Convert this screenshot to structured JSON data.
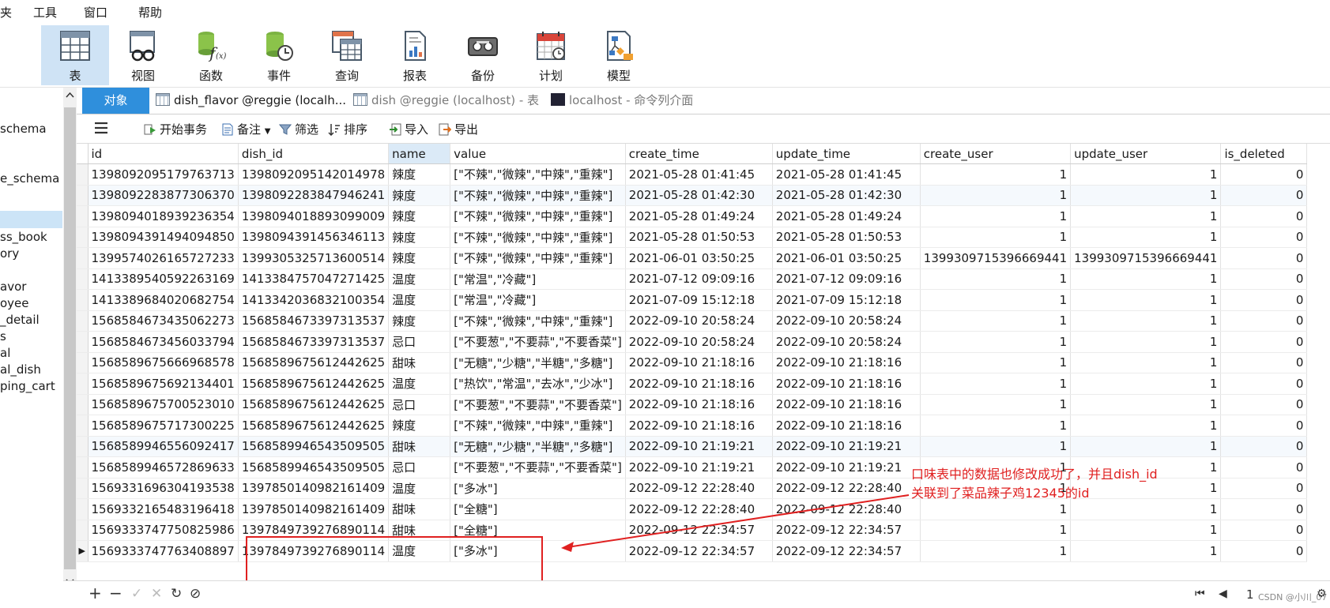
{
  "menu": [
    "夹",
    "工具",
    "窗口",
    "帮助"
  ],
  "toolbar": [
    {
      "label": "表",
      "icon": "table-icon",
      "active": true
    },
    {
      "label": "视图",
      "icon": "view-icon"
    },
    {
      "label": "函数",
      "icon": "function-icon"
    },
    {
      "label": "事件",
      "icon": "event-icon"
    },
    {
      "label": "查询",
      "icon": "query-icon"
    },
    {
      "label": "报表",
      "icon": "report-icon"
    },
    {
      "label": "备份",
      "icon": "backup-icon"
    },
    {
      "label": "计划",
      "icon": "schedule-icon"
    },
    {
      "label": "模型",
      "icon": "model-icon"
    }
  ],
  "sidebar": [
    "schema",
    "e_schema",
    "ss_book",
    "ory",
    "avor",
    "oyee",
    "_detail",
    "s",
    "al",
    "al_dish",
    "ping_cart"
  ],
  "tabs": {
    "objects": "对象",
    "tab1": "dish_flavor @reggie (localh...",
    "tab2": "dish @reggie (localhost) - 表",
    "tab3": "localhost - 命令列介面"
  },
  "grid_toolbar": {
    "begin": "开始事务",
    "notes": "备注",
    "filter": "筛选",
    "sort": "排序",
    "import": "导入",
    "export": "导出"
  },
  "columns": [
    "id",
    "dish_id",
    "name",
    "value",
    "create_time",
    "update_time",
    "create_user",
    "update_user",
    "is_deleted"
  ],
  "rows": [
    [
      "1398092095179763713",
      "1398092095142014978",
      "辣度",
      "[\"不辣\",\"微辣\",\"中辣\",\"重辣\"]",
      "2021-05-28 01:41:45",
      "2021-05-28 01:41:45",
      "1",
      "1",
      "0"
    ],
    [
      "1398092283877306370",
      "1398092283847946241",
      "辣度",
      "[\"不辣\",\"微辣\",\"中辣\",\"重辣\"]",
      "2021-05-28 01:42:30",
      "2021-05-28 01:42:30",
      "1",
      "1",
      "0"
    ],
    [
      "1398094018939236354",
      "1398094018893099009",
      "辣度",
      "[\"不辣\",\"微辣\",\"中辣\",\"重辣\"]",
      "2021-05-28 01:49:24",
      "2021-05-28 01:49:24",
      "1",
      "1",
      "0"
    ],
    [
      "1398094391494094850",
      "1398094391456346113",
      "辣度",
      "[\"不辣\",\"微辣\",\"中辣\",\"重辣\"]",
      "2021-05-28 01:50:53",
      "2021-05-28 01:50:53",
      "1",
      "1",
      "0"
    ],
    [
      "1399574026165727233",
      "1399305325713600514",
      "辣度",
      "[\"不辣\",\"微辣\",\"中辣\",\"重辣\"]",
      "2021-06-01 03:50:25",
      "2021-06-01 03:50:25",
      "1399309715396669441",
      "1399309715396669441",
      "0"
    ],
    [
      "1413389540592263169",
      "1413384757047271425",
      "温度",
      "[\"常温\",\"冷藏\"]",
      "2021-07-12 09:09:16",
      "2021-07-12 09:09:16",
      "1",
      "1",
      "0"
    ],
    [
      "1413389684020682754",
      "1413342036832100354",
      "温度",
      "[\"常温\",\"冷藏\"]",
      "2021-07-09 15:12:18",
      "2021-07-09 15:12:18",
      "1",
      "1",
      "0"
    ],
    [
      "1568584673435062273",
      "1568584673397313537",
      "辣度",
      "[\"不辣\",\"微辣\",\"中辣\",\"重辣\"]",
      "2022-09-10 20:58:24",
      "2022-09-10 20:58:24",
      "1",
      "1",
      "0"
    ],
    [
      "1568584673456033794",
      "1568584673397313537",
      "忌口",
      "[\"不要葱\",\"不要蒜\",\"不要香菜\"]",
      "2022-09-10 20:58:24",
      "2022-09-10 20:58:24",
      "1",
      "1",
      "0"
    ],
    [
      "1568589675666968578",
      "1568589675612442625",
      "甜味",
      "[\"无糖\",\"少糖\",\"半糖\",\"多糖\"]",
      "2022-09-10 21:18:16",
      "2022-09-10 21:18:16",
      "1",
      "1",
      "0"
    ],
    [
      "1568589675692134401",
      "1568589675612442625",
      "温度",
      "[\"热饮\",\"常温\",\"去冰\",\"少冰\"]",
      "2022-09-10 21:18:16",
      "2022-09-10 21:18:16",
      "1",
      "1",
      "0"
    ],
    [
      "1568589675700523010",
      "1568589675612442625",
      "忌口",
      "[\"不要葱\",\"不要蒜\",\"不要香菜\"]",
      "2022-09-10 21:18:16",
      "2022-09-10 21:18:16",
      "1",
      "1",
      "0"
    ],
    [
      "1568589675717300225",
      "1568589675612442625",
      "辣度",
      "[\"不辣\",\"微辣\",\"中辣\",\"重辣\"]",
      "2022-09-10 21:18:16",
      "2022-09-10 21:18:16",
      "1",
      "1",
      "0"
    ],
    [
      "1568589946556092417",
      "1568589946543509505",
      "甜味",
      "[\"无糖\",\"少糖\",\"半糖\",\"多糖\"]",
      "2022-09-10 21:19:21",
      "2022-09-10 21:19:21",
      "1",
      "1",
      "0"
    ],
    [
      "1568589946572869633",
      "1568589946543509505",
      "忌口",
      "[\"不要葱\",\"不要蒜\",\"不要香菜\"]",
      "2022-09-10 21:19:21",
      "2022-09-10 21:19:21",
      "1",
      "1",
      "0"
    ],
    [
      "1569331696304193538",
      "1397850140982161409",
      "温度",
      "[\"多冰\"]",
      "2022-09-12 22:28:40",
      "2022-09-12 22:28:40",
      "1",
      "1",
      "0"
    ],
    [
      "1569332165483196418",
      "1397850140982161409",
      "甜味",
      "[\"全糖\"]",
      "2022-09-12 22:28:40",
      "2022-09-12 22:28:40",
      "1",
      "1",
      "0"
    ],
    [
      "1569333747750825986",
      "1397849739276890114",
      "甜味",
      "[\"全糖\"]",
      "2022-09-12 22:34:57",
      "2022-09-12 22:34:57",
      "1",
      "1",
      "0"
    ],
    [
      "1569333747763408897",
      "1397849739276890114",
      "温度",
      "[\"多冰\"]",
      "2022-09-12 22:34:57",
      "2022-09-12 22:34:57",
      "1",
      "1",
      "0"
    ]
  ],
  "annotation": {
    "line1": "口味表中的数据也修改成功了，并且dish_id",
    "line2": "关联到了菜品辣子鸡12345的id"
  },
  "status": {
    "page": "1",
    "watermark": "CSDN @小川_07"
  }
}
